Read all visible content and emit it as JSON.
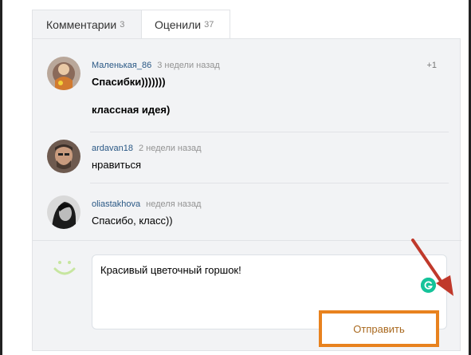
{
  "tabs": [
    {
      "label": "Комментарии",
      "count": "3"
    },
    {
      "label": "Оценили",
      "count": "37"
    }
  ],
  "comments": [
    {
      "author": "Маленькая_86",
      "time": "3 недели назад",
      "lines": [
        "Спасибки)))))))",
        "классная идея)"
      ],
      "likes": "+1"
    },
    {
      "author": "ardavan18",
      "time": "2 недели назад",
      "lines": [
        "нравиться"
      ]
    },
    {
      "author": "oliastakhova",
      "time": "неделя назад",
      "lines": [
        "Спасибо, класс))"
      ]
    }
  ],
  "composer": {
    "input_value": "Красивый цветочный горшок!",
    "send_label": "Отправить"
  },
  "colors": {
    "accent": "#e8821e",
    "link": "#2a5885",
    "grammarly": "#15c39a",
    "arrow": "#c0392b"
  },
  "icons": [
    "smiley-icon",
    "grammarly-icon",
    "arrow-annotation"
  ]
}
